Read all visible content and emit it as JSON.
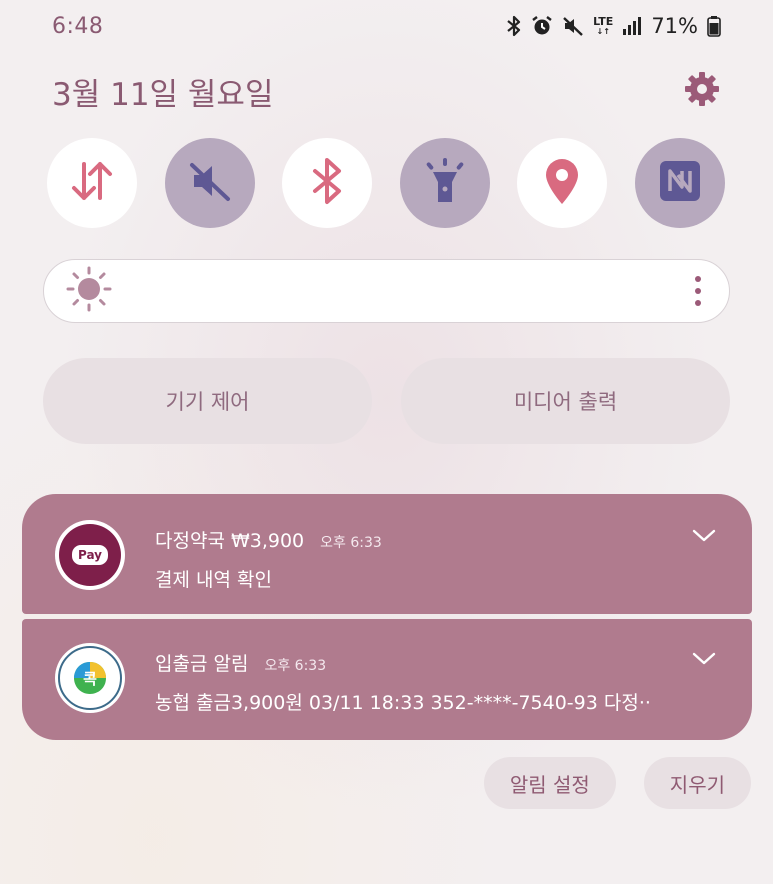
{
  "status_bar": {
    "time": "6:48",
    "lte_label": "LTE",
    "battery_percent": "71%",
    "icons": [
      "bluetooth-icon",
      "alarm-icon",
      "mute-icon",
      "lte-icon",
      "signal-icon",
      "battery-icon"
    ]
  },
  "header": {
    "date": "3월 11일 월요일",
    "settings_icon": "gear-icon"
  },
  "quick_settings": [
    {
      "name": "mobile-data",
      "icon": "data-arrows-icon",
      "state": "on"
    },
    {
      "name": "sound",
      "icon": "mute-icon",
      "state": "off"
    },
    {
      "name": "bluetooth",
      "icon": "bluetooth-icon",
      "state": "on"
    },
    {
      "name": "flashlight",
      "icon": "flashlight-icon",
      "state": "off"
    },
    {
      "name": "location",
      "icon": "location-pin-icon",
      "state": "on"
    },
    {
      "name": "nfc",
      "icon": "nfc-icon",
      "state": "off"
    }
  ],
  "brightness": {
    "icon": "sun-icon",
    "more_icon": "more-vertical-icon"
  },
  "controls": {
    "device_control_label": "기기 제어",
    "media_output_label": "미디어 출력"
  },
  "notifications": [
    {
      "app_icon": "pay-icon",
      "app_badge": "Pay",
      "title": "다정약국 ₩3,900",
      "time": "오후 6:33",
      "text": "결제 내역 확인"
    },
    {
      "app_icon": "kok-icon",
      "app_badge": "콕",
      "title": "입출금 알림",
      "time": "오후 6:33",
      "text": "농협 출금3,900원 03/11 18:33 352-****-7540-93 다정··"
    }
  ],
  "footer": {
    "notification_settings_label": "알림 설정",
    "clear_label": "지우기"
  },
  "colors": {
    "accent": "#8a5a72",
    "notification_bg": "#b07b8e",
    "tile_on": "#ffffff",
    "tile_off": "#b7a9be",
    "icon_on": "#d96a80",
    "icon_off": "#5e5894"
  }
}
